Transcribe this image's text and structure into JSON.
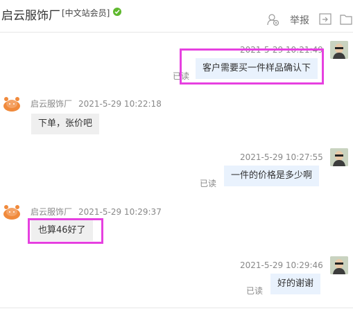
{
  "header": {
    "title": "启云服饰厂",
    "badge": "[中文站会员]",
    "report_label": "举报",
    "icons": [
      "user-add-icon",
      "verified-check-icon",
      "share-icon",
      "folder-icon"
    ]
  },
  "messages": [
    {
      "from": "self",
      "time": "2021-5-29 10:21:49",
      "text": "客户需要买一件样品确认下",
      "status": "已读"
    },
    {
      "from": "shop",
      "name": "启云服饰厂",
      "time": "2021-5-29 10:22:18",
      "text": "下单，张价吧"
    },
    {
      "from": "self",
      "time": "2021-5-29 10:27:55",
      "text": "一件的价格是多少啊",
      "status": "已读"
    },
    {
      "from": "shop",
      "name": "启云服饰厂",
      "time": "2021-5-29 10:29:37",
      "text": "也算46好了"
    },
    {
      "from": "self",
      "time": "2021-5-29 10:29:46",
      "text": "好的谢谢",
      "status": "已读"
    }
  ],
  "colors": {
    "highlight": "#e640e0",
    "mine_bubble": "#e9f2fd",
    "theirs_bubble": "#efefef",
    "verified": "#5fb82e"
  }
}
